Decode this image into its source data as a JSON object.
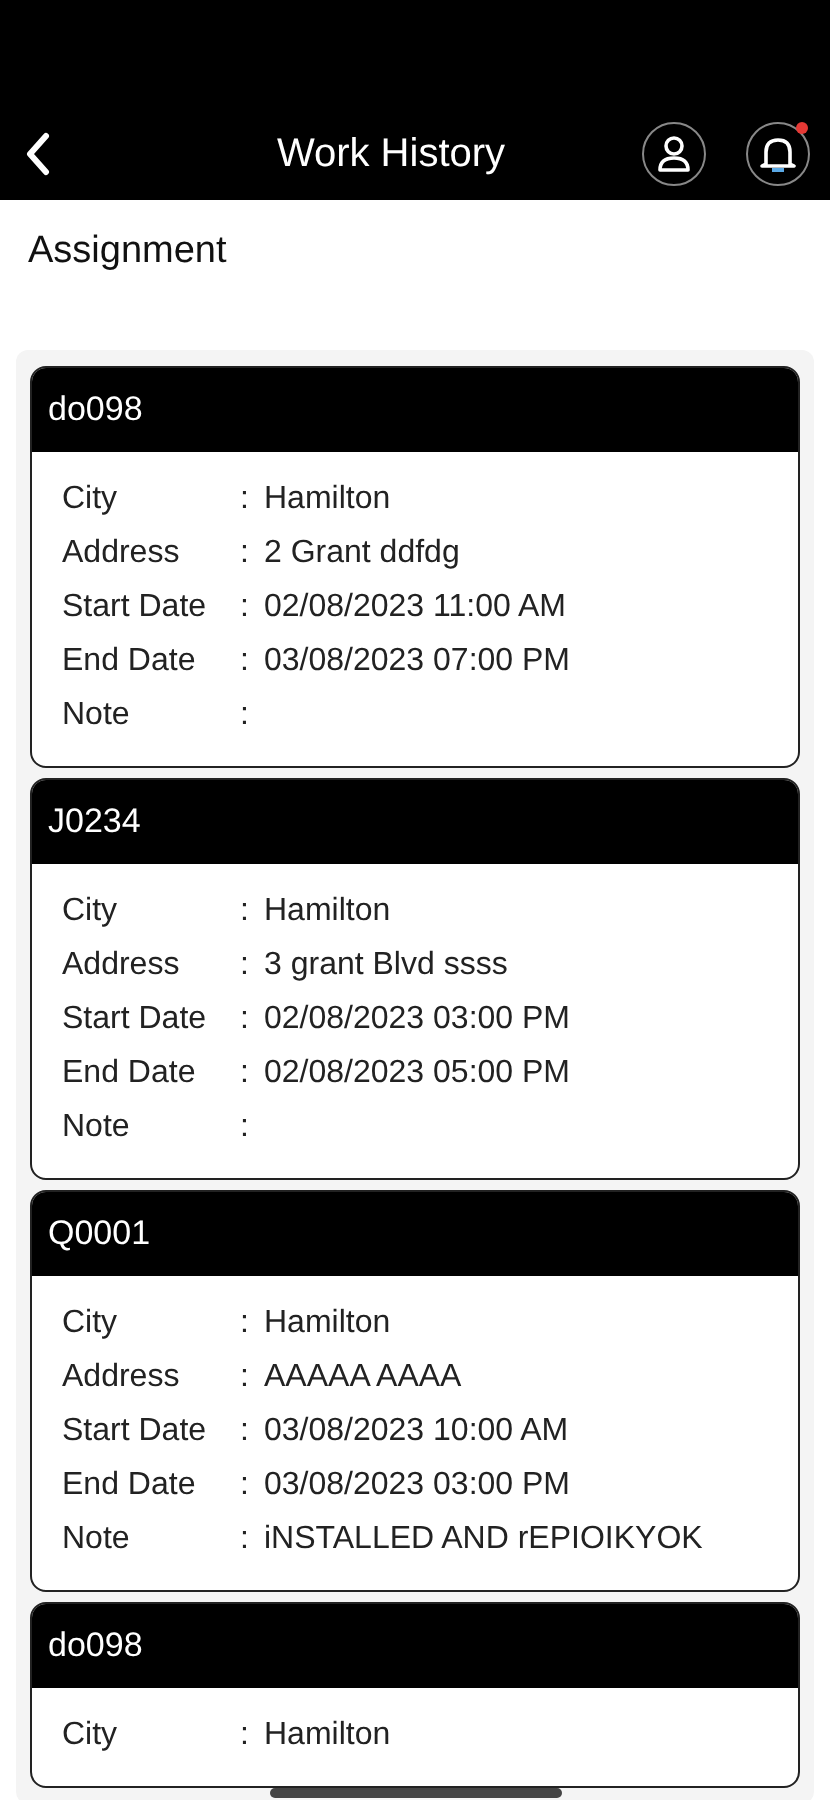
{
  "header": {
    "title": "Work History",
    "notification_unread": true
  },
  "section_title": "Assignment",
  "assignments": [
    {
      "code": "do098",
      "fields": [
        {
          "label": "City",
          "colon": ":",
          "value": "Hamilton"
        },
        {
          "label": "Address",
          "colon": ":",
          "value": "2 Grant ddfdg"
        },
        {
          "label": "Start Date",
          "colon": ":",
          "value": "02/08/2023 11:00 AM"
        },
        {
          "label": "End Date",
          "colon": ":",
          "value": "03/08/2023 07:00 PM"
        },
        {
          "label": "Note",
          "colon": ":"
        }
      ]
    },
    {
      "code": "J0234",
      "fields": [
        {
          "label": "City",
          "colon": ":",
          "value": "Hamilton"
        },
        {
          "label": "Address",
          "colon": ":",
          "value": "3 grant Blvd ssss"
        },
        {
          "label": "Start Date",
          "colon": ":",
          "value": "02/08/2023 03:00 PM"
        },
        {
          "label": "End Date",
          "colon": ":",
          "value": "02/08/2023 05:00 PM"
        },
        {
          "label": "Note",
          "colon": ":"
        }
      ]
    },
    {
      "code": "Q0001",
      "fields": [
        {
          "label": "City",
          "colon": ":",
          "value": "Hamilton"
        },
        {
          "label": "Address",
          "colon": ":",
          "value": "AAAAA AAAA"
        },
        {
          "label": "Start Date",
          "colon": ":",
          "value": "03/08/2023 10:00 AM"
        },
        {
          "label": "End Date",
          "colon": ":",
          "value": "03/08/2023 03:00 PM"
        },
        {
          "label": "Note",
          "colon": ":",
          "value": "iNSTALLED AND rEPIOIKYOK"
        }
      ]
    },
    {
      "code": "do098",
      "fields": [
        {
          "label": "City",
          "colon": ":",
          "value": "Hamilton"
        }
      ]
    }
  ]
}
